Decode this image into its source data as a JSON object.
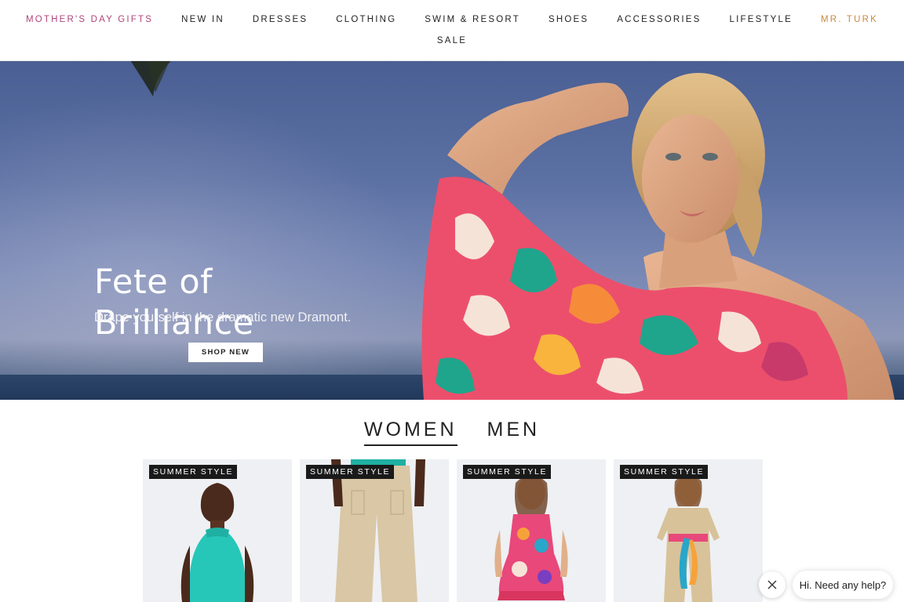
{
  "nav": {
    "row1": [
      "MOTHER'S DAY GIFTS",
      "NEW IN",
      "DRESSES",
      "CLOTHING",
      "SWIM & RESORT",
      "SHOES",
      "ACCESSORIES",
      "LIFESTYLE",
      "MR. TURK"
    ],
    "row2": [
      "SALE"
    ]
  },
  "hero": {
    "title": "Fete of Brilliance",
    "subtitle": "Drape yourself in the dramatic new Dramont.",
    "cta": "SHOP NEW"
  },
  "tabs": [
    "WOMEN",
    "MEN"
  ],
  "products": [
    {
      "badge": "SUMMER STYLE"
    },
    {
      "badge": "SUMMER STYLE"
    },
    {
      "badge": "SUMMER STYLE"
    },
    {
      "badge": "SUMMER STYLE"
    }
  ],
  "chat": {
    "prompt": "Hi. Need any help?"
  },
  "colors": {
    "gift": "#b0447a",
    "mrturk": "#c8893e",
    "sky": "#5b70a3"
  }
}
